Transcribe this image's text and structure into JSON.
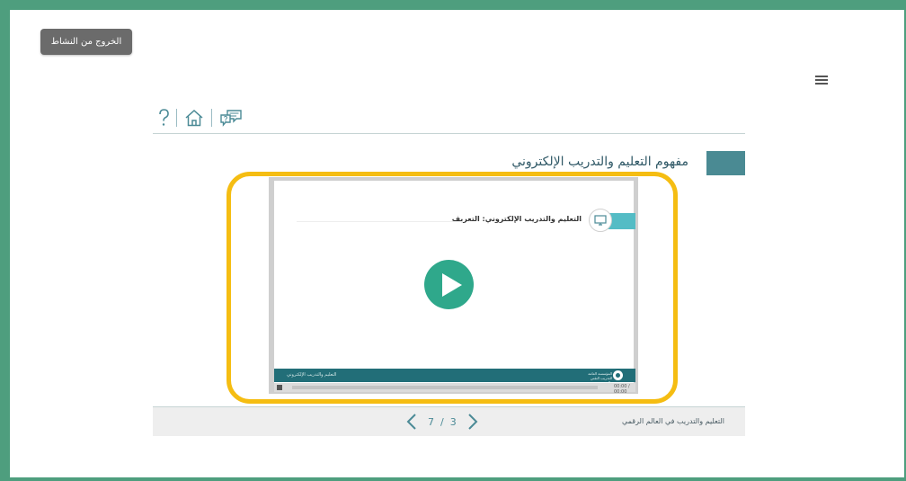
{
  "header": {
    "exit_button": "الخروج من النشاط",
    "menu_icon": "hamburger-menu-icon"
  },
  "toolbar": {
    "icons": [
      "help-question-icon",
      "home-icon",
      "discussion-forum-icon"
    ]
  },
  "section": {
    "title": "مفهوم التعليم والتدريب الإلكتروني",
    "accent_color": "#4a8a93"
  },
  "video": {
    "slide_title": "التعليم والتدريب الإلكتروني: التعريف",
    "footer_label": "التعليم والتدريب الإلكتروني",
    "footer_logo_text": "المؤسسة العامة للتدريب التقني والمهني",
    "time_text": "00:00 / 00:00",
    "play_color": "#2fa88b",
    "highlight_color": "#f5bd12"
  },
  "footer": {
    "page_current": "3",
    "page_total": "7",
    "page_separator": "/",
    "course_name": "التعليم والتدريب في العالم الرقمي"
  },
  "colors": {
    "frame": "#4e9e7e",
    "footer_bar": "#eeeeee"
  }
}
